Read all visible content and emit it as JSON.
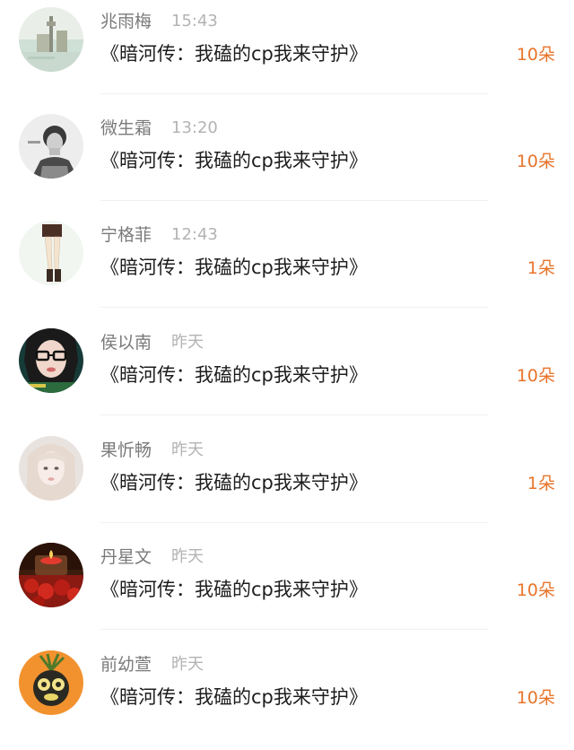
{
  "colors": {
    "name": "#7a7a7a",
    "time": "#b3b3b3",
    "message": "#1d1d1d",
    "gift": "#e8742a",
    "divider": "#f1f1f1"
  },
  "items": [
    {
      "name": "兆雨梅",
      "time": "15:43",
      "message": "《暗河传：我磕的cp我来守护》",
      "gift": "10朵",
      "avatar": "landscape-avatar"
    },
    {
      "name": "微生霜",
      "time": "13:20",
      "message": "《暗河传：我磕的cp我来守护》",
      "gift": "10朵",
      "avatar": "grayscale-portrait-avatar"
    },
    {
      "name": "宁格菲",
      "time": "12:43",
      "message": "《暗河传：我磕的cp我来守护》",
      "gift": "1朵",
      "avatar": "legs-sketch-avatar"
    },
    {
      "name": "侯以南",
      "time": "昨天",
      "message": "《暗河传：我磕的cp我来守护》",
      "gift": "10朵",
      "avatar": "glasses-girl-avatar"
    },
    {
      "name": "果忻畅",
      "time": "昨天",
      "message": "《暗河传：我磕的cp我来守护》",
      "gift": "1朵",
      "avatar": "blonde-girl-avatar"
    },
    {
      "name": "丹星文",
      "time": "昨天",
      "message": "《暗河传：我磕的cp我来守护》",
      "gift": "10朵",
      "avatar": "candle-avatar"
    },
    {
      "name": "前幼萱",
      "time": "昨天",
      "message": "《暗河传：我磕的cp我来守护》",
      "gift": "10朵",
      "avatar": "orange-fruit-character-avatar"
    }
  ]
}
